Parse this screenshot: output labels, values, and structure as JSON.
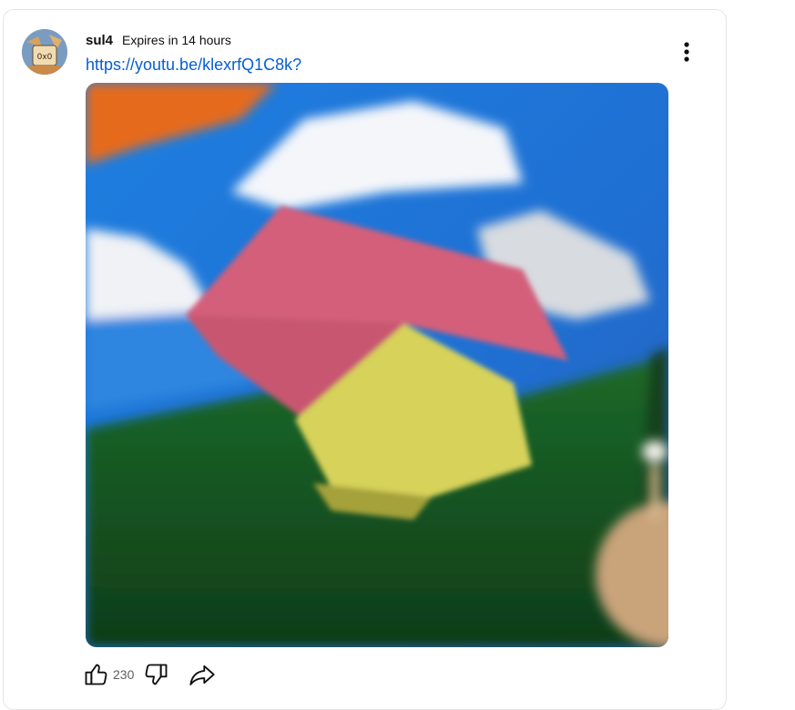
{
  "post": {
    "author": "sul4",
    "expires": "Expires in 14 hours",
    "link": "https://youtu.be/klexrfQ1C8k?",
    "likes": "230"
  },
  "avatar_text": "0x0",
  "icons": {
    "menu": "more-vert-icon",
    "like": "thumbs-up-icon",
    "dislike": "thumbs-down-icon",
    "share": "share-icon"
  },
  "colors": {
    "link": "#065fd4",
    "secondary_text": "#606060",
    "border": "#e5e5e5"
  }
}
